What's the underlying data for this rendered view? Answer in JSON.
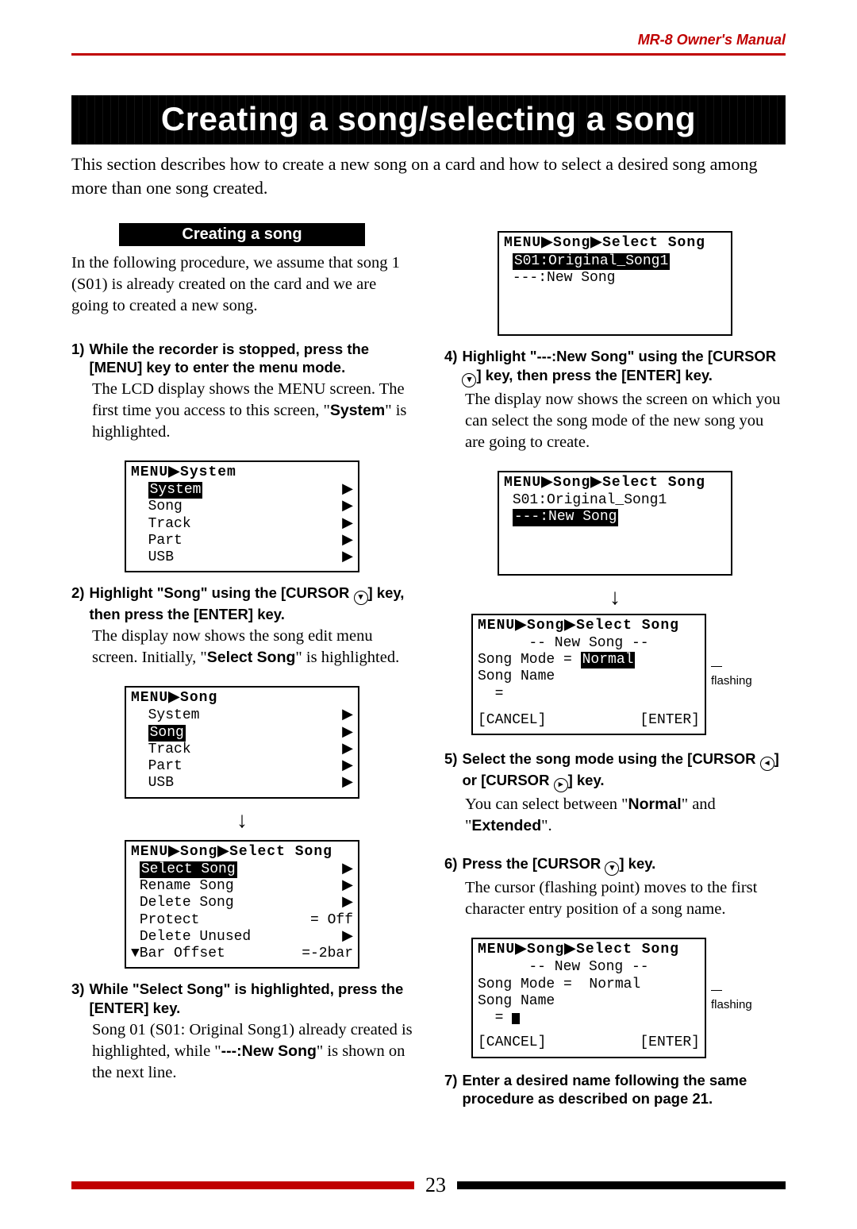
{
  "header": {
    "manual": "MR-8 Owner's Manual"
  },
  "title": "Creating a song/selecting a song",
  "intro": "This section describes how to create a new song on a card and how to select a desired song among more than one song created.",
  "section_banner": "Creating a song",
  "left_intro": "In the following procedure, we assume that song 1 (S01) is already created on the card and we are going to created a new song.",
  "steps": {
    "s1": {
      "num": "1)",
      "title": "While the recorder is stopped, press the [MENU] key to enter the menu mode.",
      "body_a": "The LCD display shows the MENU screen. The first time you access to this screen, \"",
      "body_bold": "System",
      "body_b": "\" is highlighted."
    },
    "s2": {
      "num": "2)",
      "title_a": "Highlight \"Song\" using the [CURSOR ",
      "title_b": "] key, then press the [ENTER] key.",
      "body_a": "The display now shows the song edit menu screen.  Initially, \"",
      "body_bold": "Select Song",
      "body_b": "\" is highlighted."
    },
    "s3": {
      "num": "3)",
      "title": "While \"Select Song\" is highlighted, press the [ENTER] key.",
      "body_a": "Song 01 (S01: Original Song1) already created is highlighted, while \"",
      "body_bold": "---:New Song",
      "body_b": "\" is shown on the next line."
    },
    "s4": {
      "num": "4)",
      "title_a": "Highlight \"---:New Song\" using the [CURSOR ",
      "title_b": "] key, then press the [ENTER] key.",
      "body": "The display now shows the screen on which you can select the song mode of the new song you are going to create."
    },
    "s5": {
      "num": "5)",
      "title_a": "Select the song mode using the [CURSOR ",
      "title_mid": "] or [CURSOR ",
      "title_b": "] key.",
      "body_a": "You can select between \"",
      "body_bold1": "Normal",
      "body_mid": "\" and \"",
      "body_bold2": "Extended",
      "body_b": "\"."
    },
    "s6": {
      "num": "6)",
      "title_a": "Press the [CURSOR ",
      "title_b": "] key.",
      "body": "The cursor (flashing point) moves to the first character entry position of a song name."
    },
    "s7": {
      "num": "7)",
      "title": "Enter a desired name following the same procedure as described on page 21."
    }
  },
  "lcd": {
    "menu1": {
      "breadcrumb": "MENU▶System",
      "items": [
        "System",
        "Song",
        "Track",
        "Part",
        "USB"
      ],
      "highlight": 0
    },
    "menu2": {
      "breadcrumb": "MENU▶Song",
      "items": [
        "System",
        "Song",
        "Track",
        "Part",
        "USB"
      ],
      "highlight": 1
    },
    "menu3": {
      "breadcrumb": "MENU▶Song▶Select Song",
      "rows": [
        {
          "label": "Select Song",
          "tri": "▶",
          "hl": true
        },
        {
          "label": "Rename Song",
          "tri": "▶"
        },
        {
          "label": "Delete Song",
          "tri": "▶"
        },
        {
          "label": "Protect",
          "val": "= Off"
        },
        {
          "label": "Delete Unused",
          "tri": "▶"
        },
        {
          "label": "▼Bar Offset",
          "val": "=-2bar"
        }
      ]
    },
    "sel1": {
      "breadcrumb": "MENU▶Song▶Select Song",
      "line1_hl": "S01:Original_Song1",
      "line2": "---:New Song"
    },
    "sel2": {
      "breadcrumb": "MENU▶Song▶Select Song",
      "line1": "S01:Original_Song1",
      "line2_hl": "---:New Song"
    },
    "new1": {
      "breadcrumb": "MENU▶Song▶Select Song",
      "title": "-- New Song --",
      "mode_label": "Song Mode = ",
      "mode_value": "Normal",
      "name_label": "Song Name",
      "eq": "=",
      "btn_cancel": "[CANCEL]",
      "btn_enter": "[ENTER]"
    },
    "new2": {
      "breadcrumb": "MENU▶Song▶Select Song",
      "title": "-- New Song --",
      "mode_line": "Song Mode =  Normal",
      "name_label": "Song Name",
      "eq": "= ",
      "btn_cancel": "[CANCEL]",
      "btn_enter": "[ENTER]"
    }
  },
  "labels": {
    "flashing": "flashing"
  },
  "cursor_glyphs": {
    "down": "▾",
    "left": "◂",
    "right": "▸"
  },
  "page_number": "23"
}
